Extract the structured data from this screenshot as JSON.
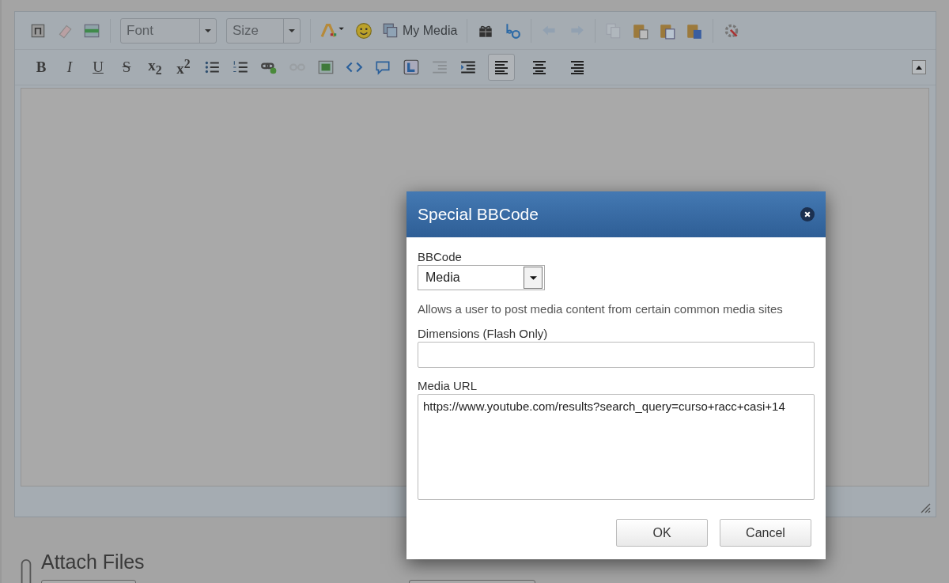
{
  "editor": {
    "toolbar": {
      "font_select": {
        "placeholder": "Font"
      },
      "size_select": {
        "placeholder": "Size"
      },
      "media_button": {
        "label": "My Media"
      },
      "undo": {
        "disabled": true
      },
      "redo": {
        "disabled": true
      },
      "copy": {
        "disabled": true
      },
      "format_buttons": [
        {
          "label": "B"
        },
        {
          "label": "I"
        },
        {
          "label": "U"
        },
        {
          "label": "S"
        },
        {
          "label": "x$_{2}$"
        },
        {
          "label": "x$^{2}$"
        }
      ],
      "unlink": {
        "disabled": true
      },
      "outdent": {
        "disabled": true
      },
      "alignment": [
        {
          "selected": true
        },
        {
          "selected": false
        },
        {
          "selected": false
        }
      ]
    }
  },
  "attachments": {
    "title": "Attach Files"
  },
  "dialog": {
    "title": "Special BBCode",
    "bbcode_label": "BBCode",
    "bbcode_select": {
      "value": "Media"
    },
    "description": "Allows a user to post media content from certain common media sites",
    "dimensions_label": "Dimensions (Flash Only)",
    "url_label": "Media URL",
    "url_field": {
      "value": "https://www.youtube.com/results?search_query=curso+racc+casi+14"
    },
    "buttons": [
      {
        "label": "OK"
      },
      {
        "label": "Cancel"
      }
    ]
  }
}
